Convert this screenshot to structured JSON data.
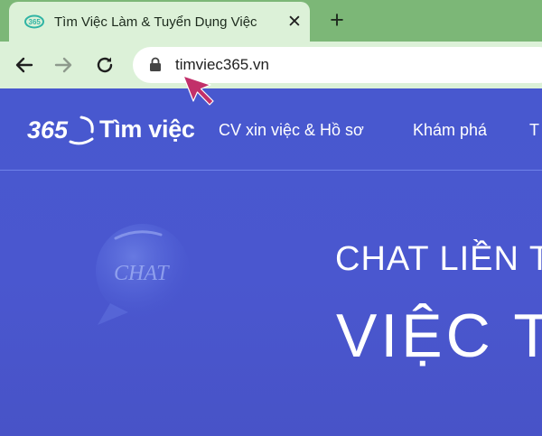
{
  "browser": {
    "tab": {
      "title": "Tìm Việc Làm & Tuyển Dụng Việc",
      "close_glyph": "✕",
      "favicon": "timviec365-favicon-icon"
    },
    "new_tab_glyph": "+",
    "toolbar": {
      "back_icon": "arrow-left-icon",
      "forward_icon": "arrow-right-icon",
      "reload_icon": "reload-icon"
    },
    "address_bar": {
      "url": "timviec365.vn",
      "secure_icon": "lock-icon"
    },
    "cursor_color": "#c2306a"
  },
  "site": {
    "logo": {
      "number": "365",
      "text": "Tìm việc"
    },
    "menu": [
      {
        "label": "CV xin việc & Hồ sơ"
      },
      {
        "label": "Khám phá"
      },
      {
        "label": "T"
      }
    ],
    "hero": {
      "chat_label": "CHAT",
      "headline_1": "CHAT LIỀN TA",
      "headline_2": "VIỆC TỐ"
    }
  },
  "colors": {
    "tab_strip": "#7cb777",
    "tab_active": "#dcf1d8",
    "page_background": "#4a58cf",
    "accent_text": "#ffffff"
  }
}
